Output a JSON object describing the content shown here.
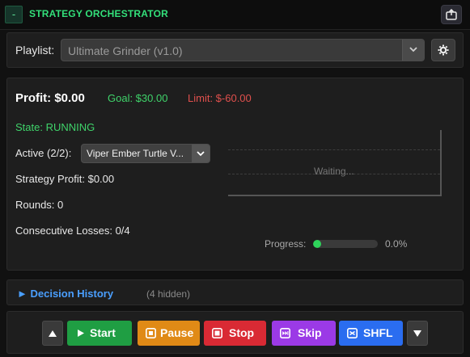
{
  "header": {
    "collapse_label": "-",
    "title": "STRATEGY ORCHESTRATOR",
    "popout_icon": "popout-icon"
  },
  "playlist": {
    "label": "Playlist:",
    "selected": "Ultimate Grinder (v1.0)",
    "settings_icon": "gear-icon"
  },
  "summary": {
    "profit": "Profit: $0.00",
    "goal": "Goal: $30.00",
    "limit": "Limit: $-60.00",
    "state": "State: RUNNING",
    "active_label": "Active (2/2):",
    "active_selected": "Viper Ember Turtle V...",
    "strategy_profit": "Strategy Profit: $0.00",
    "rounds": "Rounds: 0",
    "consecutive_losses": "Consecutive Losses: 0/4"
  },
  "chart": {
    "placeholder": "Waiting..."
  },
  "progress": {
    "label": "Progress:",
    "percent": 0,
    "value_text": "0.0%"
  },
  "history": {
    "title": "► Decision History",
    "hidden_count": "(4 hidden)"
  },
  "controls": {
    "up_icon": "triangle-up-icon",
    "start": "Start",
    "pause": "Pause",
    "stop": "Stop",
    "skip": "Skip",
    "shuffle": "SHFL",
    "down_icon": "triangle-down-icon"
  },
  "colors": {
    "accent_green": "#33e07a",
    "danger_red": "#e0504d",
    "link_blue": "#4a9fff",
    "start": "#1f9e43",
    "pause": "#e08a16",
    "stop": "#d92a34",
    "skip": "#9b3ae6",
    "shuffle": "#2a6df0"
  }
}
